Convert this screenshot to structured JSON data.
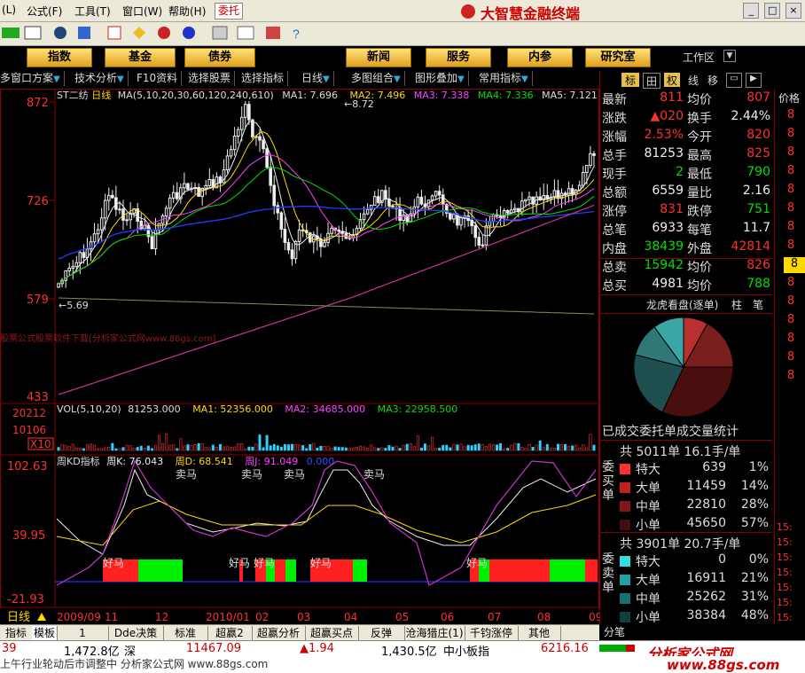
{
  "menubar": {
    "items": [
      "(L)",
      "公式(F)",
      "工具(T)",
      "窗口(W)",
      "帮助(H)"
    ],
    "entrust_btn": "委托",
    "app_title": "大智慧金融终端"
  },
  "navbar": {
    "buttons": [
      "指数",
      "基金",
      "债券",
      "新闻",
      "服务",
      "内参",
      "研究室"
    ],
    "workspace": "工作区"
  },
  "subbar": {
    "items": [
      "多窗口方案",
      "技术分析",
      "F10资料",
      "选择股票",
      "选择指标",
      "日线",
      "多图组合",
      "图形叠加",
      "常用指标"
    ]
  },
  "chart": {
    "header": {
      "stock_name": "ST二纺",
      "period": "日线",
      "ma_label": "MA(5,10,20,30,60,120,240,610)",
      "ma1": "MA1: 7.696",
      "ma2": "MA2: 7.496",
      "ma3": "MA3: 7.338",
      "ma4": "MA4: 7.336",
      "ma5": "MA5: 7.121"
    },
    "price_axis": [
      "872",
      "726",
      "579",
      "433"
    ],
    "high_mark": "8.72",
    "low_mark": "5.69",
    "watermark": "股票公式股票软件下载[分析家公式网www.88gs.com]",
    "vol": {
      "label": "VOL(5,10,20)",
      "value": "81253.000",
      "ma1": "MA1: 52356.000",
      "ma2": "MA2: 34685.000",
      "ma3": "MA3: 22958.500",
      "axis": [
        "20212",
        "10106",
        "X10"
      ]
    },
    "kd": {
      "label": "周KD指标",
      "k": "周K: 76.043",
      "d": "周D: 68.541",
      "j": "周J: 91.049",
      "extra": "0.000",
      "axis": [
        "102.63",
        "39.95",
        "-21.93"
      ],
      "sell_labels": [
        "卖马",
        "卖马",
        "卖马",
        "卖马"
      ],
      "buy_labels": [
        "好马",
        "好马",
        "好马",
        "好马",
        "好马"
      ]
    },
    "date_axis": {
      "period_label": "日线",
      "dates": [
        "2009/09",
        "11",
        "12",
        "2010/01",
        "02",
        "03",
        "04",
        "05",
        "06",
        "07",
        "08",
        "09"
      ]
    }
  },
  "quote": {
    "rows1": [
      {
        "l1": "最新",
        "v1": "811",
        "l2": "均价",
        "v2": "807",
        "c1": "red",
        "c2": "red"
      },
      {
        "l1": "涨跌",
        "v1": "▲020",
        "l2": "换手",
        "v2": "2.44%",
        "c1": "red",
        "c2": "white"
      },
      {
        "l1": "涨幅",
        "v1": "2.53%",
        "l2": "今开",
        "v2": "820",
        "c1": "red",
        "c2": "red"
      },
      {
        "l1": "总手",
        "v1": "81253",
        "l2": "最高",
        "v2": "825",
        "c1": "white",
        "c2": "red"
      },
      {
        "l1": "现手",
        "v1": "2",
        "l2": "最低",
        "v2": "790",
        "c1": "green",
        "c2": "green"
      },
      {
        "l1": "总额",
        "v1": "6559",
        "l2": "量比",
        "v2": "2.16",
        "c1": "white",
        "c2": "white"
      },
      {
        "l1": "涨停",
        "v1": "831",
        "l2": "跌停",
        "v2": "751",
        "c1": "red",
        "c2": "green"
      },
      {
        "l1": "总笔",
        "v1": "6933",
        "l2": "每笔",
        "v2": "11.7",
        "c1": "white",
        "c2": "white"
      },
      {
        "l1": "内盘",
        "v1": "38439",
        "l2": "外盘",
        "v2": "42814",
        "c1": "green",
        "c2": "red"
      },
      {
        "l1": "总卖",
        "v1": "15942",
        "l2": "均价",
        "v2": "826",
        "c1": "green",
        "c2": "red"
      },
      {
        "l1": "总买",
        "v1": "4981",
        "l2": "均价",
        "v2": "788",
        "c1": "white",
        "c2": "green"
      }
    ],
    "tabs": [
      "标",
      "田",
      "权",
      "线",
      "移"
    ],
    "dragon_title": "龙虎看盘(逐单)",
    "dragon_tabs": [
      "柱",
      "笔"
    ],
    "pie_slices": [
      {
        "value": 0.08,
        "color": "#b83030"
      },
      {
        "value": 0.17,
        "color": "#7a1e1e"
      },
      {
        "value": 0.32,
        "color": "#4a0e0e"
      },
      {
        "value": 0.22,
        "color": "#1f4e4e"
      },
      {
        "value": 0.11,
        "color": "#2e7878"
      },
      {
        "value": 0.1,
        "color": "#3aa6a6"
      }
    ],
    "stats_title": "已成交委托单成交量统计",
    "buy_section": {
      "side_label": "委买单",
      "summary": "共 5011单 16.1手/单",
      "rows": [
        {
          "label": "特大",
          "vol": "639",
          "pct": "1%",
          "color": "#ff3030"
        },
        {
          "label": "大单",
          "vol": "11459",
          "pct": "14%",
          "color": "#c02020"
        },
        {
          "label": "中单",
          "vol": "22810",
          "pct": "28%",
          "color": "#801818"
        },
        {
          "label": "小单",
          "vol": "45650",
          "pct": "57%",
          "color": "#401010"
        }
      ]
    },
    "sell_section": {
      "side_label": "委卖单",
      "summary": "共 3901单 20.7手/单",
      "rows": [
        {
          "label": "特大",
          "vol": "0",
          "pct": "0%",
          "color": "#30e0e0"
        },
        {
          "label": "大单",
          "vol": "16911",
          "pct": "21%",
          "color": "#20a0a0"
        },
        {
          "label": "中单",
          "vol": "25262",
          "pct": "31%",
          "color": "#187070"
        },
        {
          "label": "小单",
          "vol": "38384",
          "pct": "48%",
          "color": "#0e4040"
        }
      ]
    },
    "fenbi": "分笔"
  },
  "far_right": {
    "header": "价格",
    "values": [
      "8",
      "8",
      "8",
      "8",
      "8",
      "8",
      "8",
      "8",
      "8",
      "8",
      "8",
      "8",
      "8",
      "8",
      "8"
    ],
    "highlight": "8",
    "times": [
      "15:",
      "15:",
      "15:",
      "15:",
      "15:",
      "15:",
      "15:"
    ]
  },
  "tabbar": {
    "tabs": [
      "指标",
      "模板",
      "1",
      "Dde决策",
      "标准",
      "超赢2",
      "超赢分析",
      "超赢买点",
      "反弹",
      "沧海猎庄(1)",
      "千钧涨停",
      "其他"
    ]
  },
  "statusbar": {
    "item1": "39",
    "item2": "1,472.8亿",
    "item3": "深",
    "item4": "11467.09",
    "item5": "▲1.94",
    "item6": "1,430.5亿",
    "item7": "中小板指",
    "item8": "6216.16"
  },
  "ticker": {
    "text": "上午行业轮动后市调整中 分析家公式网 www.88gs.com"
  },
  "colors": {
    "up": "#ff3030",
    "down": "#00e000",
    "frame": "#800000",
    "accent": "#ffd800"
  }
}
